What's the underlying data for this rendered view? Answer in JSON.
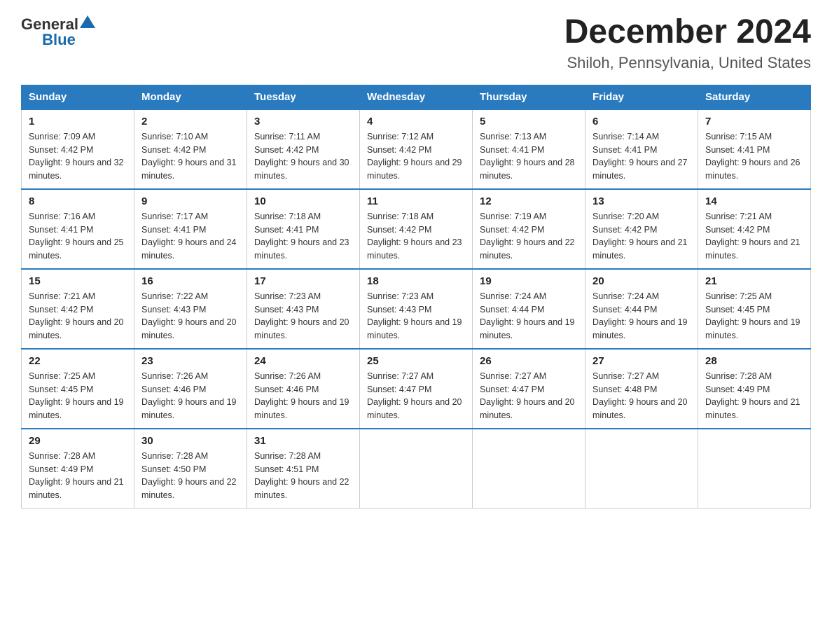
{
  "header": {
    "logo_general": "General",
    "logo_blue": "Blue",
    "month_title": "December 2024",
    "location": "Shiloh, Pennsylvania, United States"
  },
  "days_of_week": [
    "Sunday",
    "Monday",
    "Tuesday",
    "Wednesday",
    "Thursday",
    "Friday",
    "Saturday"
  ],
  "weeks": [
    [
      {
        "day": "1",
        "sunrise": "7:09 AM",
        "sunset": "4:42 PM",
        "daylight": "9 hours and 32 minutes."
      },
      {
        "day": "2",
        "sunrise": "7:10 AM",
        "sunset": "4:42 PM",
        "daylight": "9 hours and 31 minutes."
      },
      {
        "day": "3",
        "sunrise": "7:11 AM",
        "sunset": "4:42 PM",
        "daylight": "9 hours and 30 minutes."
      },
      {
        "day": "4",
        "sunrise": "7:12 AM",
        "sunset": "4:42 PM",
        "daylight": "9 hours and 29 minutes."
      },
      {
        "day": "5",
        "sunrise": "7:13 AM",
        "sunset": "4:41 PM",
        "daylight": "9 hours and 28 minutes."
      },
      {
        "day": "6",
        "sunrise": "7:14 AM",
        "sunset": "4:41 PM",
        "daylight": "9 hours and 27 minutes."
      },
      {
        "day": "7",
        "sunrise": "7:15 AM",
        "sunset": "4:41 PM",
        "daylight": "9 hours and 26 minutes."
      }
    ],
    [
      {
        "day": "8",
        "sunrise": "7:16 AM",
        "sunset": "4:41 PM",
        "daylight": "9 hours and 25 minutes."
      },
      {
        "day": "9",
        "sunrise": "7:17 AM",
        "sunset": "4:41 PM",
        "daylight": "9 hours and 24 minutes."
      },
      {
        "day": "10",
        "sunrise": "7:18 AM",
        "sunset": "4:41 PM",
        "daylight": "9 hours and 23 minutes."
      },
      {
        "day": "11",
        "sunrise": "7:18 AM",
        "sunset": "4:42 PM",
        "daylight": "9 hours and 23 minutes."
      },
      {
        "day": "12",
        "sunrise": "7:19 AM",
        "sunset": "4:42 PM",
        "daylight": "9 hours and 22 minutes."
      },
      {
        "day": "13",
        "sunrise": "7:20 AM",
        "sunset": "4:42 PM",
        "daylight": "9 hours and 21 minutes."
      },
      {
        "day": "14",
        "sunrise": "7:21 AM",
        "sunset": "4:42 PM",
        "daylight": "9 hours and 21 minutes."
      }
    ],
    [
      {
        "day": "15",
        "sunrise": "7:21 AM",
        "sunset": "4:42 PM",
        "daylight": "9 hours and 20 minutes."
      },
      {
        "day": "16",
        "sunrise": "7:22 AM",
        "sunset": "4:43 PM",
        "daylight": "9 hours and 20 minutes."
      },
      {
        "day": "17",
        "sunrise": "7:23 AM",
        "sunset": "4:43 PM",
        "daylight": "9 hours and 20 minutes."
      },
      {
        "day": "18",
        "sunrise": "7:23 AM",
        "sunset": "4:43 PM",
        "daylight": "9 hours and 19 minutes."
      },
      {
        "day": "19",
        "sunrise": "7:24 AM",
        "sunset": "4:44 PM",
        "daylight": "9 hours and 19 minutes."
      },
      {
        "day": "20",
        "sunrise": "7:24 AM",
        "sunset": "4:44 PM",
        "daylight": "9 hours and 19 minutes."
      },
      {
        "day": "21",
        "sunrise": "7:25 AM",
        "sunset": "4:45 PM",
        "daylight": "9 hours and 19 minutes."
      }
    ],
    [
      {
        "day": "22",
        "sunrise": "7:25 AM",
        "sunset": "4:45 PM",
        "daylight": "9 hours and 19 minutes."
      },
      {
        "day": "23",
        "sunrise": "7:26 AM",
        "sunset": "4:46 PM",
        "daylight": "9 hours and 19 minutes."
      },
      {
        "day": "24",
        "sunrise": "7:26 AM",
        "sunset": "4:46 PM",
        "daylight": "9 hours and 19 minutes."
      },
      {
        "day": "25",
        "sunrise": "7:27 AM",
        "sunset": "4:47 PM",
        "daylight": "9 hours and 20 minutes."
      },
      {
        "day": "26",
        "sunrise": "7:27 AM",
        "sunset": "4:47 PM",
        "daylight": "9 hours and 20 minutes."
      },
      {
        "day": "27",
        "sunrise": "7:27 AM",
        "sunset": "4:48 PM",
        "daylight": "9 hours and 20 minutes."
      },
      {
        "day": "28",
        "sunrise": "7:28 AM",
        "sunset": "4:49 PM",
        "daylight": "9 hours and 21 minutes."
      }
    ],
    [
      {
        "day": "29",
        "sunrise": "7:28 AM",
        "sunset": "4:49 PM",
        "daylight": "9 hours and 21 minutes."
      },
      {
        "day": "30",
        "sunrise": "7:28 AM",
        "sunset": "4:50 PM",
        "daylight": "9 hours and 22 minutes."
      },
      {
        "day": "31",
        "sunrise": "7:28 AM",
        "sunset": "4:51 PM",
        "daylight": "9 hours and 22 minutes."
      },
      null,
      null,
      null,
      null
    ]
  ]
}
